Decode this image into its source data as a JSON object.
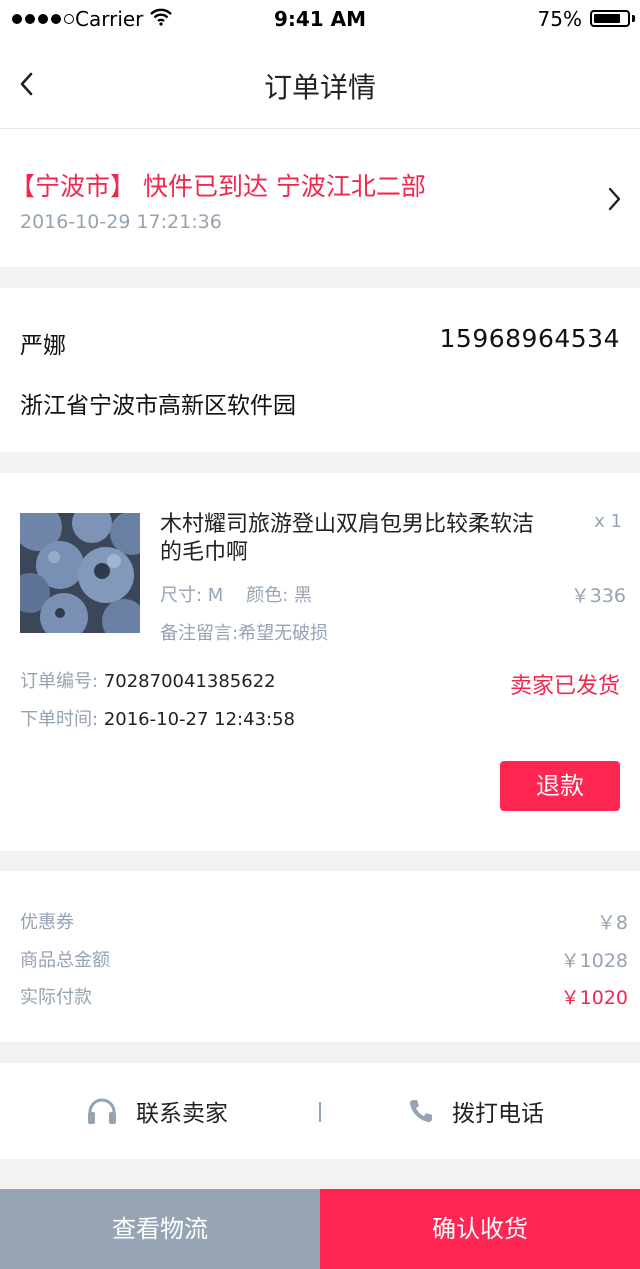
{
  "status_bar": {
    "carrier": "Carrier",
    "time": "9:41 AM",
    "battery": "75%"
  },
  "nav": {
    "title": "订单详情"
  },
  "logistics": {
    "message": "【宁波市】 快件已到达 宁波江北二部",
    "time": "2016-10-29   17:21:36"
  },
  "address": {
    "name": "严娜",
    "phone": "15968964534",
    "line": "浙江省宁波市高新区软件园"
  },
  "product": {
    "title": "木村耀司旅游登山双肩包男比较柔软洁的毛巾啊",
    "qty": "x 1",
    "spec": "尺寸: M    颜色: 黑",
    "price": "￥336",
    "note": "备注留言:希望无破损"
  },
  "order": {
    "number_label": "订单编号:",
    "number": "702870041385622",
    "time_label": "下单时间:",
    "time": "2016-10-27 12:43:58",
    "status": "卖家已发货",
    "refund_label": "退款"
  },
  "summary": {
    "rows": [
      {
        "label": "优惠券",
        "value": "￥8"
      },
      {
        "label": "商品总金额",
        "value": "￥1028"
      },
      {
        "label": "实际付款",
        "value": "￥1020"
      }
    ]
  },
  "contact": {
    "seller_label": "联系卖家",
    "call_label": "拨打电话"
  },
  "bottom": {
    "logistics_label": "查看物流",
    "confirm_label": "确认收货"
  },
  "colors": {
    "accent": "#ff2652",
    "muted": "#97a4b4",
    "gray_text": "#96a3b3",
    "background": "#f4f1f1"
  }
}
